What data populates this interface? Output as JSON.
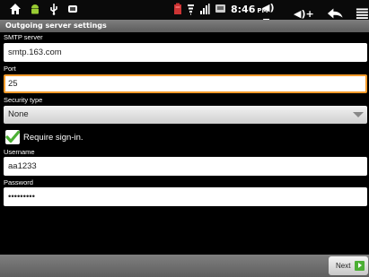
{
  "status_bar": {
    "time": "8:46",
    "ampm": "PM",
    "icons": [
      "home-icon",
      "android-icon",
      "usb-icon",
      "notification-icon",
      "battery-icon",
      "wifi-icon",
      "signal-icon",
      "sd-card-icon"
    ],
    "volume_down": "◀)−",
    "volume_up": "◀)+",
    "back_icon": "back-icon",
    "menu_icon": "menu-icon"
  },
  "title": "Outgoing server settings",
  "fields": {
    "smtp_label": "SMTP server",
    "smtp_value": "smtp.163.com",
    "port_label": "Port",
    "port_value": "25",
    "security_label": "Security type",
    "security_value": "None",
    "signin_label": "Require sign-in.",
    "signin_checked": true,
    "username_label": "Username",
    "username_value": "aa1233",
    "password_label": "Password",
    "password_value": "•••••••••"
  },
  "buttons": {
    "next": "Next"
  },
  "colors": {
    "focus": "#f39b2b",
    "check": "#4caf34",
    "background": "#000000"
  }
}
